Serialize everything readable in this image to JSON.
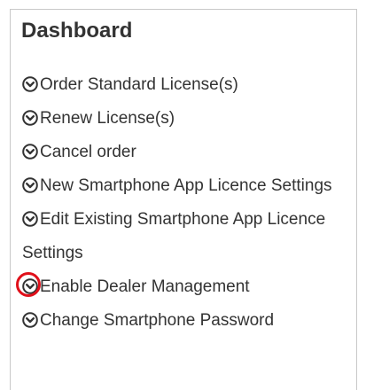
{
  "dashboard": {
    "title": "Dashboard",
    "items": [
      {
        "label": "Order Standard License(s)",
        "icon": "chevron-circle-down-icon"
      },
      {
        "label": "Renew License(s)",
        "icon": "chevron-circle-down-icon"
      },
      {
        "label": "Cancel order",
        "icon": "chevron-circle-down-icon"
      },
      {
        "label": "New Smartphone App Licence Settings",
        "icon": "chevron-circle-down-icon"
      },
      {
        "label": "Edit Existing Smartphone App Licence Settings",
        "icon": "chevron-circle-down-icon"
      },
      {
        "label": "Enable Dealer Management",
        "icon": "chevron-circle-down-icon",
        "highlighted": true
      },
      {
        "label": "Change Smartphone Password",
        "icon": "chevron-circle-down-icon"
      }
    ]
  },
  "colors": {
    "text": "#333333",
    "border": "#c8c8c8",
    "highlight": "#e0101a"
  }
}
